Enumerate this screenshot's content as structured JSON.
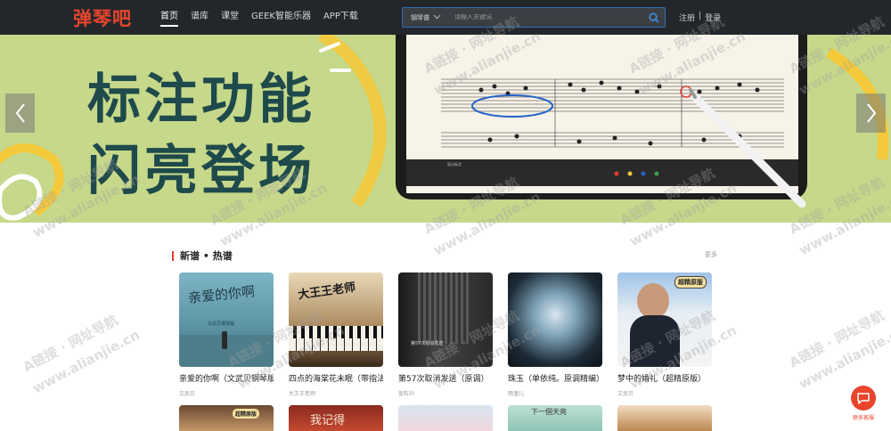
{
  "brand": {
    "logo_text": "弹琴吧",
    "accent": "#e8452c"
  },
  "nav": {
    "items": [
      {
        "label": "首页",
        "active": true
      },
      {
        "label": "谱库"
      },
      {
        "label": "课堂"
      },
      {
        "label": "GEEK智能乐器"
      },
      {
        "label": "APP下载"
      }
    ]
  },
  "search": {
    "type_label": "钢琴谱",
    "placeholder": "请输入关键词"
  },
  "auth": {
    "register": "注册",
    "divider": "|",
    "login": "登录"
  },
  "banner": {
    "line1": "标注功能",
    "line2": "闪亮登场",
    "toggle_label": "显示标注"
  },
  "section": {
    "title": "新谱 • 热谱",
    "more": "更多"
  },
  "cards": [
    {
      "title": "亲爱的你啊（文武贝钢琴版）",
      "author": "文武贝",
      "cover_text": "亲爱的你啊",
      "cover_sub": "文武贝钢琴版"
    },
    {
      "title": "四点的海棠花未眠（带指法）",
      "author": "大王王老师",
      "cover_text": "大王王老师"
    },
    {
      "title": "第57次取消发送（原调）",
      "author": "饭粒升",
      "cover_text": "第57次取消发送"
    },
    {
      "title": "珠玉（单依纯。原调精编）",
      "author": "雨潼儿"
    },
    {
      "title": "梦中的婚礼（超精原版）",
      "author": "文武贝",
      "cover_text": "超精原版"
    }
  ],
  "row2": [
    "超精原版",
    "我记得",
    "下一個天亮"
  ],
  "watermarks": [
    "A链接 · 网址导航",
    "www.alianjie.cn"
  ],
  "service": {
    "label": "联系客服"
  }
}
